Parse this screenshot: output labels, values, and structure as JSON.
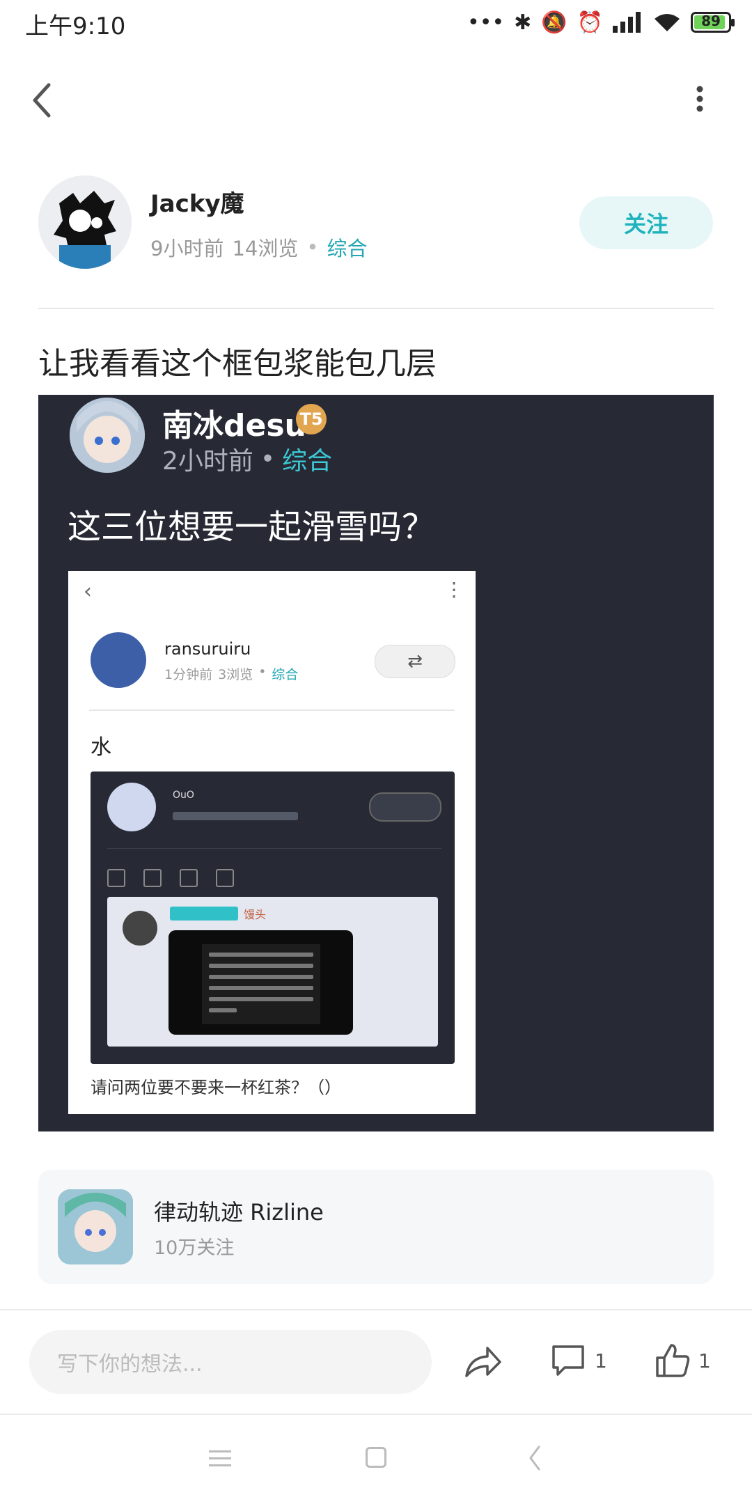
{
  "status_bar": {
    "time": "上午9:10",
    "battery": "89"
  },
  "author": {
    "name": "Jacky魔",
    "time": "9小时前",
    "views": "14浏览",
    "category": "综合",
    "follow_label": "关注"
  },
  "post": {
    "title": "让我看看这个框包浆能包几层"
  },
  "embedded": {
    "name": "南冰desu",
    "badge": "T5",
    "time": "2小时前",
    "category": "综合",
    "text": "这三位想要一起滑雪吗？",
    "inner": {
      "name": "ransuruiru",
      "time": "1分钟前",
      "views": "3浏览",
      "category": "综合",
      "text": "水",
      "dark_name": "OuO",
      "card_title": "馒头",
      "bottom_text": "请问两位要不要来一杯红茶？（）"
    }
  },
  "community": {
    "name": "律动轨迹 Rizline",
    "followers": "10万关注"
  },
  "actions": {
    "comment_placeholder": "写下你的想法...",
    "comment_count": "1",
    "like_count": "1"
  }
}
